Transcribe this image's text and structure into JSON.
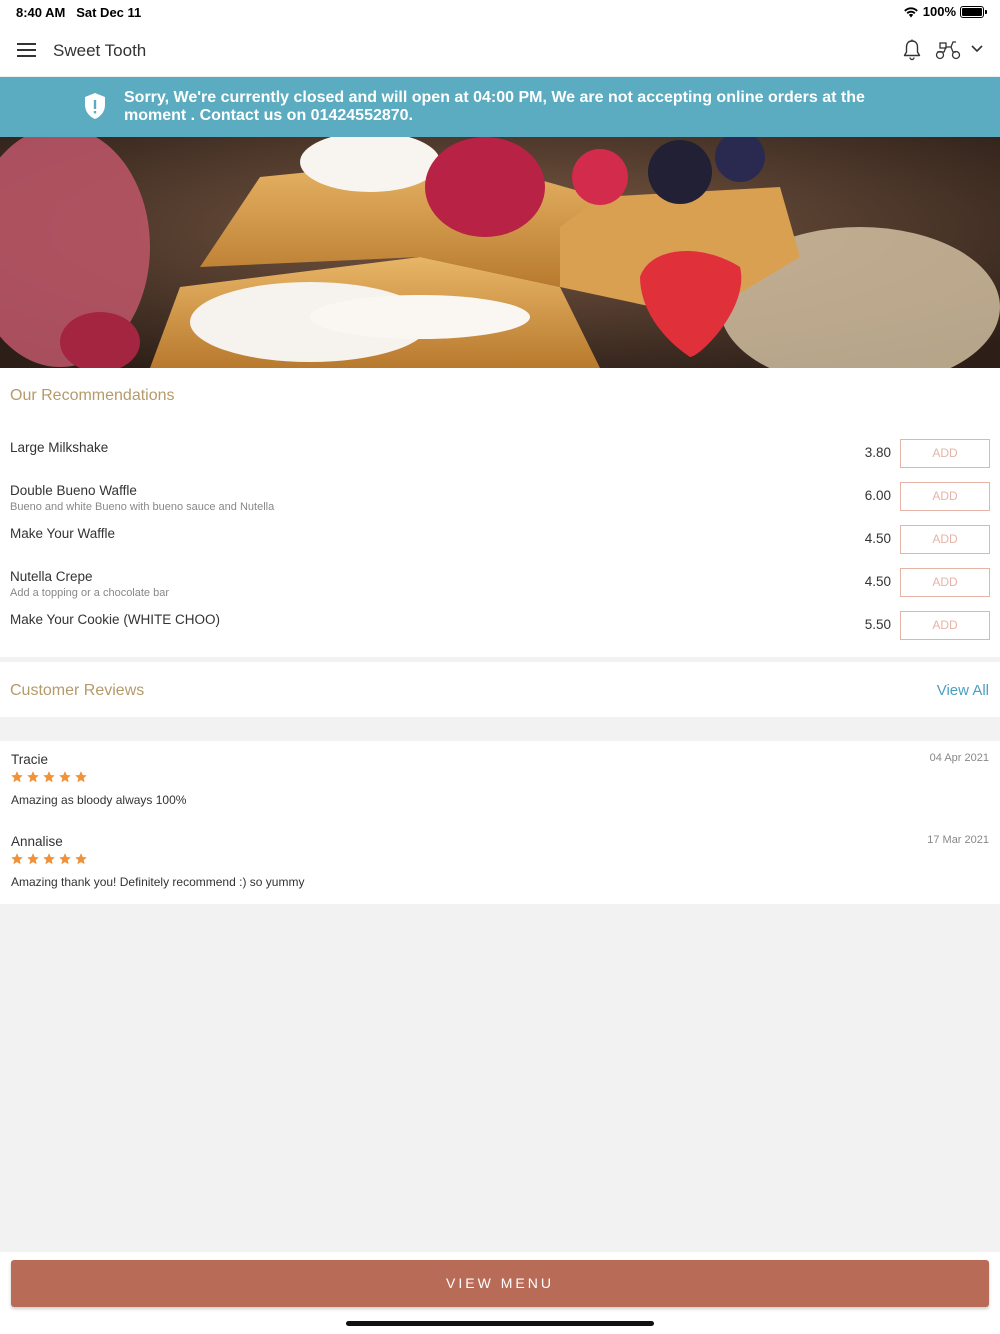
{
  "status": {
    "time": "8:40 AM",
    "date": "Sat Dec 11",
    "battery": "100%"
  },
  "header": {
    "title": "Sweet Tooth",
    "icons": [
      "menu-icon",
      "bell-icon",
      "scooter-icon",
      "chevron-down-icon"
    ]
  },
  "banner": {
    "text": "Sorry, We're currently closed and will open at 04:00 PM, We are not accepting online orders at the moment . Contact us on  01424552870.",
    "color": "#5bacc0"
  },
  "recommendations": {
    "title": "Our Recommendations",
    "add_label": "ADD",
    "items": [
      {
        "name": "Large Milkshake",
        "desc": "",
        "price": "3.80"
      },
      {
        "name": "Double Bueno Waffle",
        "desc": "Bueno and white Bueno with bueno sauce and Nutella",
        "price": "6.00"
      },
      {
        "name": "Make Your Waffle",
        "desc": "",
        "price": "4.50"
      },
      {
        "name": "Nutella Crepe",
        "desc": "Add a topping or a chocolate bar",
        "price": "4.50"
      },
      {
        "name": "Make Your Cookie (WHITE CHOO)",
        "desc": "",
        "price": "5.50"
      }
    ]
  },
  "reviews": {
    "title": "Customer Reviews",
    "view_all": "View All",
    "items": [
      {
        "name": "Tracie",
        "date": "04 Apr 2021",
        "rating": 5,
        "text": "Amazing as bloody always 100%"
      },
      {
        "name": "Annalise",
        "date": "17 Mar 2021",
        "rating": 5,
        "text": "Amazing thank you! Definitely recommend :) so yummy"
      }
    ]
  },
  "footer": {
    "button_label": "VIEW MENU",
    "button_color": "#b86b57"
  },
  "colors": {
    "accent_gold": "#b59a6a",
    "link_blue": "#4a9fc0",
    "star_orange": "#f0923a"
  }
}
